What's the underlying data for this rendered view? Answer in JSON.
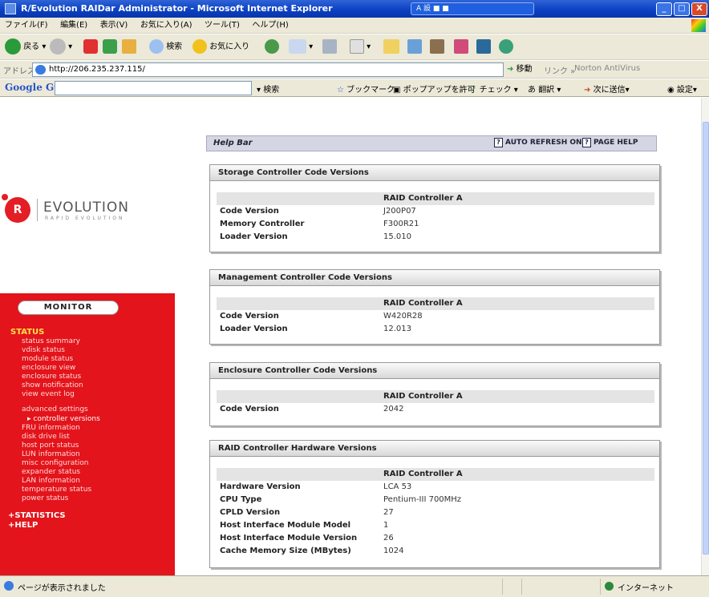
{
  "window": {
    "title": "R/Evolution RAIDar Administrator - Microsoft Internet Explorer",
    "tray_text": "A 設 ■ ■",
    "buttons": [
      "_",
      "□",
      "X"
    ]
  },
  "menu": [
    "ファイル(F)",
    "編集(E)",
    "表示(V)",
    "お気に入り(A)",
    "ツール(T)",
    "ヘルプ(H)"
  ],
  "toolbar": {
    "back": "戻る",
    "search": "検索",
    "favorites": "お気に入り"
  },
  "address": {
    "label": "アドレス(D)",
    "url": "http://206.235.237.115/",
    "go": "移動",
    "links": "リンク »",
    "norton": "Norton AntiVirus"
  },
  "googlebar": {
    "logo": "Google",
    "search": "検索",
    "bookmarks": "ブックマーク",
    "popup": "ポップアップを許可",
    "check": "チェック",
    "translate": "翻訳",
    "send": "次に送信",
    "settings": "設定"
  },
  "logo": {
    "mark": "R",
    "word": "EVOLUTION",
    "sub": "RAPID EVOLUTION"
  },
  "sidebar": {
    "monitor": "MONITOR",
    "status_head": "STATUS",
    "status_items": [
      "status summary",
      "vdisk status",
      "module status",
      "enclosure view",
      "enclosure status",
      "show notification",
      "view event log"
    ],
    "advanced": "advanced settings",
    "current": "▸ controller versions",
    "advanced_items": [
      "FRU information",
      "disk drive list",
      "host port status",
      "LUN information",
      "misc configuration",
      "expander status",
      "LAN information",
      "temperature status",
      "power status"
    ],
    "statistics": "+STATISTICS",
    "help": "+HELP"
  },
  "helpbar": {
    "title": "Help Bar",
    "auto_refresh": "AUTO REFRESH ON",
    "page_help": "PAGE HELP"
  },
  "panels": [
    {
      "title": "Storage Controller Code Versions",
      "column": "RAID Controller A",
      "rows": [
        {
          "k": "Code Version",
          "v": "J200P07"
        },
        {
          "k": "Memory Controller",
          "v": "F300R21"
        },
        {
          "k": "Loader Version",
          "v": "15.010"
        }
      ]
    },
    {
      "title": "Management Controller Code Versions",
      "column": "RAID Controller A",
      "rows": [
        {
          "k": "Code Version",
          "v": "W420R28"
        },
        {
          "k": "Loader Version",
          "v": "12.013"
        }
      ]
    },
    {
      "title": "Enclosure Controller Code Versions",
      "column": "RAID Controller A",
      "rows": [
        {
          "k": "Code Version",
          "v": "2042"
        }
      ]
    },
    {
      "title": "RAID Controller Hardware Versions",
      "column": "RAID Controller A",
      "rows": [
        {
          "k": "Hardware Version",
          "v": "LCA 53"
        },
        {
          "k": "CPU Type",
          "v": "Pentium-III 700MHz"
        },
        {
          "k": "CPLD Version",
          "v": "27"
        },
        {
          "k": "Host Interface Module Model",
          "v": "1"
        },
        {
          "k": "Host Interface Module Version",
          "v": "26"
        },
        {
          "k": "Cache Memory Size (MBytes)",
          "v": "1024"
        }
      ]
    }
  ],
  "status": {
    "text": "ページが表示されました",
    "zone": "インターネット"
  }
}
